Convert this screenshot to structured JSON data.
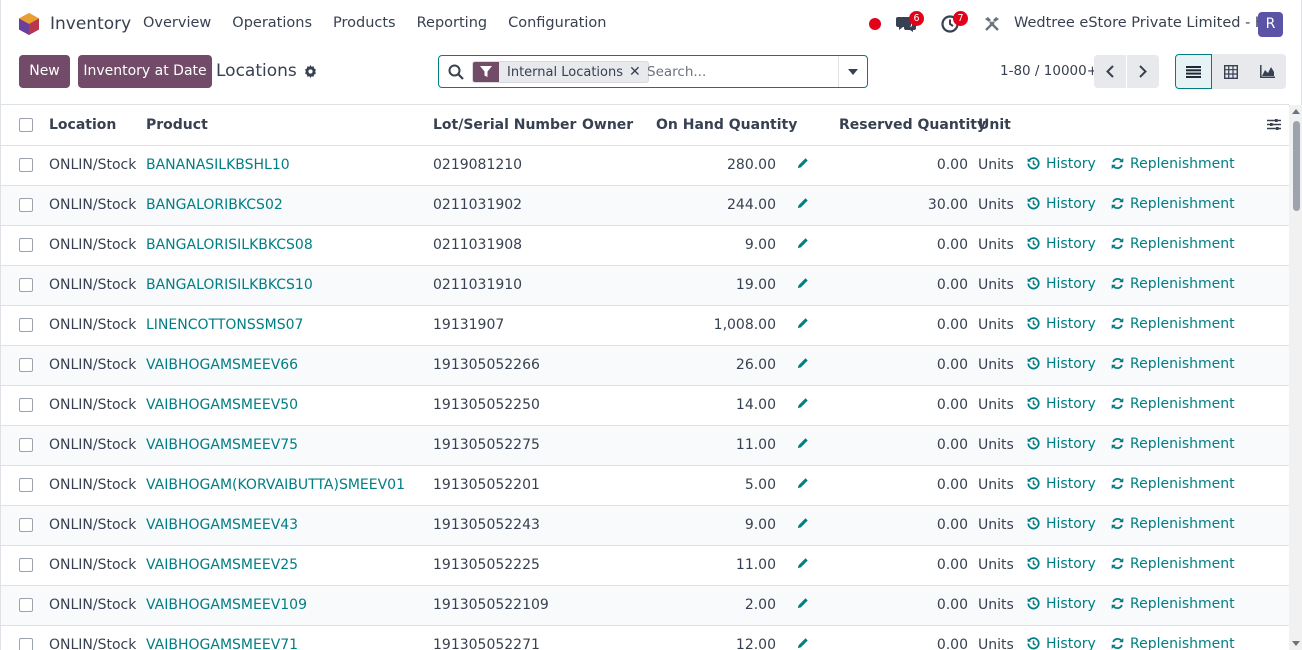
{
  "app": {
    "name": "Inventory"
  },
  "menu": [
    "Overview",
    "Operations",
    "Products",
    "Reporting",
    "Configuration"
  ],
  "systray": {
    "messages_count": "6",
    "activities_count": "7",
    "company": "Wedtree eStore Private Limited - HO",
    "avatar_initial": "R"
  },
  "actions": {
    "new_label": "New",
    "inventory_at_date_label": "Inventory at Date"
  },
  "breadcrumb": {
    "title": "Locations"
  },
  "search": {
    "facet_label": "Internal Locations",
    "placeholder": "Search..."
  },
  "pager": {
    "value": "1-80 / 10000+"
  },
  "colors": {
    "primary": "#714b67",
    "link": "#017e84",
    "badge": "#e3001b",
    "avatar": "#5b54a6"
  },
  "table": {
    "headers": {
      "location": "Location",
      "product": "Product",
      "lot": "Lot/Serial Number",
      "owner": "Owner",
      "on_hand": "On Hand Quantity",
      "reserved": "Reserved Quantity",
      "unit": "Unit"
    },
    "history_label": "History",
    "replenishment_label": "Replenishment",
    "rows": [
      {
        "location": "ONLIN/Stock",
        "product": "BANANASILKBSHL10",
        "lot": "0219081210",
        "owner": "",
        "on_hand": "280.00",
        "reserved": "0.00",
        "unit": "Units"
      },
      {
        "location": "ONLIN/Stock",
        "product": "BANGALORIBKCS02",
        "lot": "0211031902",
        "owner": "",
        "on_hand": "244.00",
        "reserved": "30.00",
        "unit": "Units"
      },
      {
        "location": "ONLIN/Stock",
        "product": "BANGALORISILKBKCS08",
        "lot": "0211031908",
        "owner": "",
        "on_hand": "9.00",
        "reserved": "0.00",
        "unit": "Units"
      },
      {
        "location": "ONLIN/Stock",
        "product": "BANGALORISILKBKCS10",
        "lot": "0211031910",
        "owner": "",
        "on_hand": "19.00",
        "reserved": "0.00",
        "unit": "Units"
      },
      {
        "location": "ONLIN/Stock",
        "product": "LINENCOTTONSSMS07",
        "lot": "19131907",
        "owner": "",
        "on_hand": "1,008.00",
        "reserved": "0.00",
        "unit": "Units"
      },
      {
        "location": "ONLIN/Stock",
        "product": "VAIBHOGAMSMEEV66",
        "lot": "191305052266",
        "owner": "",
        "on_hand": "26.00",
        "reserved": "0.00",
        "unit": "Units"
      },
      {
        "location": "ONLIN/Stock",
        "product": "VAIBHOGAMSMEEV50",
        "lot": "191305052250",
        "owner": "",
        "on_hand": "14.00",
        "reserved": "0.00",
        "unit": "Units"
      },
      {
        "location": "ONLIN/Stock",
        "product": "VAIBHOGAMSMEEV75",
        "lot": "191305052275",
        "owner": "",
        "on_hand": "11.00",
        "reserved": "0.00",
        "unit": "Units"
      },
      {
        "location": "ONLIN/Stock",
        "product": "VAIBHOGAM(KORVAIBUTTA)SMEEV01",
        "lot": "191305052201",
        "owner": "",
        "on_hand": "5.00",
        "reserved": "0.00",
        "unit": "Units"
      },
      {
        "location": "ONLIN/Stock",
        "product": "VAIBHOGAMSMEEV43",
        "lot": "191305052243",
        "owner": "",
        "on_hand": "9.00",
        "reserved": "0.00",
        "unit": "Units"
      },
      {
        "location": "ONLIN/Stock",
        "product": "VAIBHOGAMSMEEV25",
        "lot": "191305052225",
        "owner": "",
        "on_hand": "11.00",
        "reserved": "0.00",
        "unit": "Units"
      },
      {
        "location": "ONLIN/Stock",
        "product": "VAIBHOGAMSMEEV109",
        "lot": "1913050522109",
        "owner": "",
        "on_hand": "2.00",
        "reserved": "0.00",
        "unit": "Units"
      },
      {
        "location": "ONLIN/Stock",
        "product": "VAIBHOGAMSMEEV71",
        "lot": "191305052271",
        "owner": "",
        "on_hand": "12.00",
        "reserved": "0.00",
        "unit": "Units"
      }
    ]
  }
}
